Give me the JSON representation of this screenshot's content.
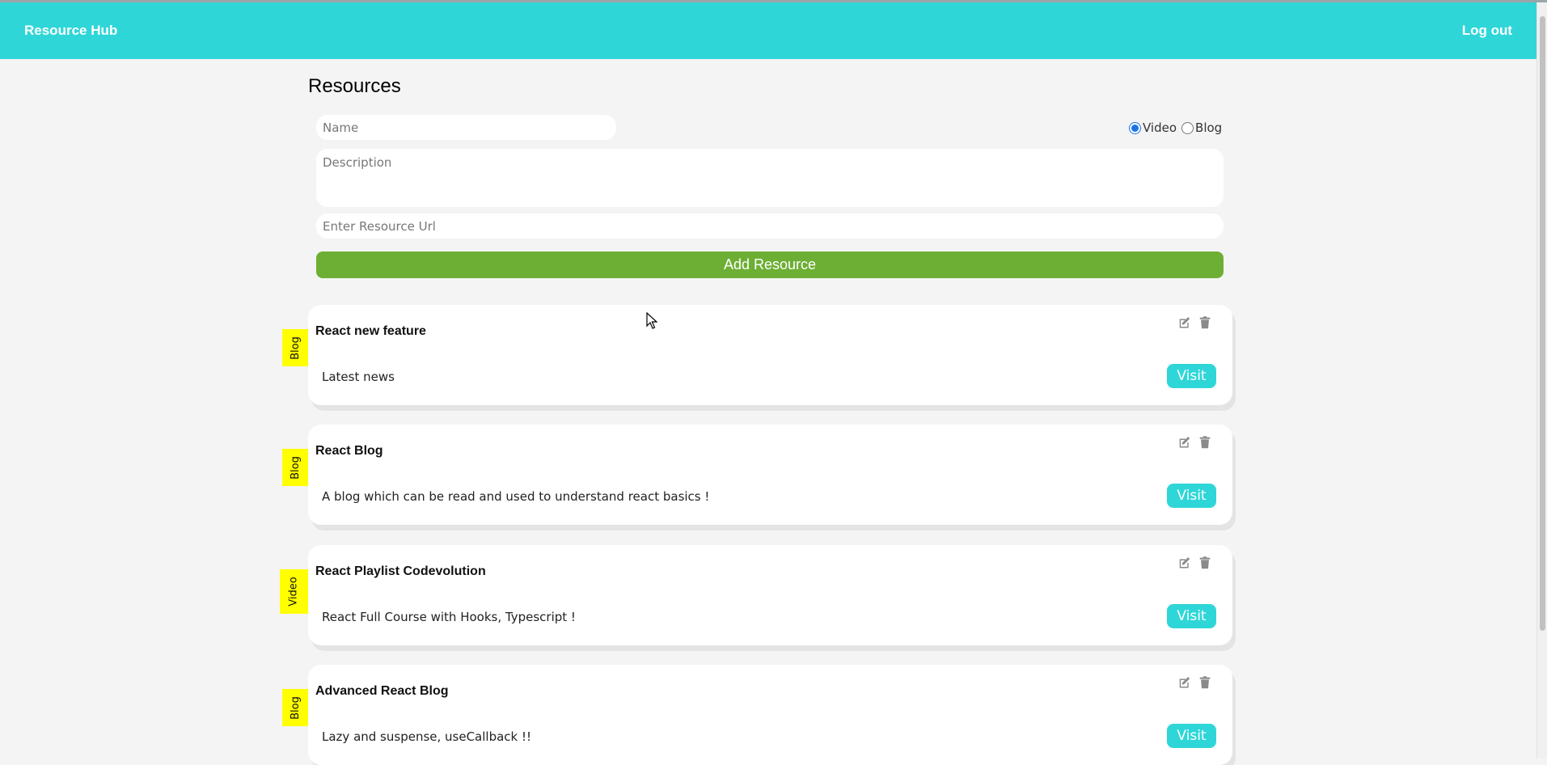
{
  "navbar": {
    "brand": "Resource Hub",
    "logout": "Log out"
  },
  "form": {
    "title": "Resources",
    "name_placeholder": "Name",
    "description_placeholder": "Description",
    "url_placeholder": "Enter Resource Url",
    "radio_options": [
      {
        "label": "Video",
        "checked": true
      },
      {
        "label": "Blog",
        "checked": false
      }
    ],
    "submit_label": "Add Resource"
  },
  "resources": [
    {
      "type": "Blog",
      "title": "React new feature",
      "description": "Latest news",
      "visit_label": "Visit"
    },
    {
      "type": "Blog",
      "title": "React Blog",
      "description": "A blog which can be read and used to understand react basics !",
      "visit_label": "Visit"
    },
    {
      "type": "Video",
      "title": "React Playlist Codevolution",
      "description": "React Full Course with Hooks, Typescript !",
      "visit_label": "Visit"
    },
    {
      "type": "Blog",
      "title": "Advanced React Blog",
      "description": "Lazy and suspense, useCallback !!",
      "visit_label": "Visit"
    }
  ],
  "icons": {
    "edit": "edit-icon",
    "delete": "trash-icon"
  },
  "colors": {
    "header": "#2fd6d8",
    "add_button": "#6daf34",
    "tag": "#ffff00",
    "visit_button": "#2fd6d8"
  }
}
